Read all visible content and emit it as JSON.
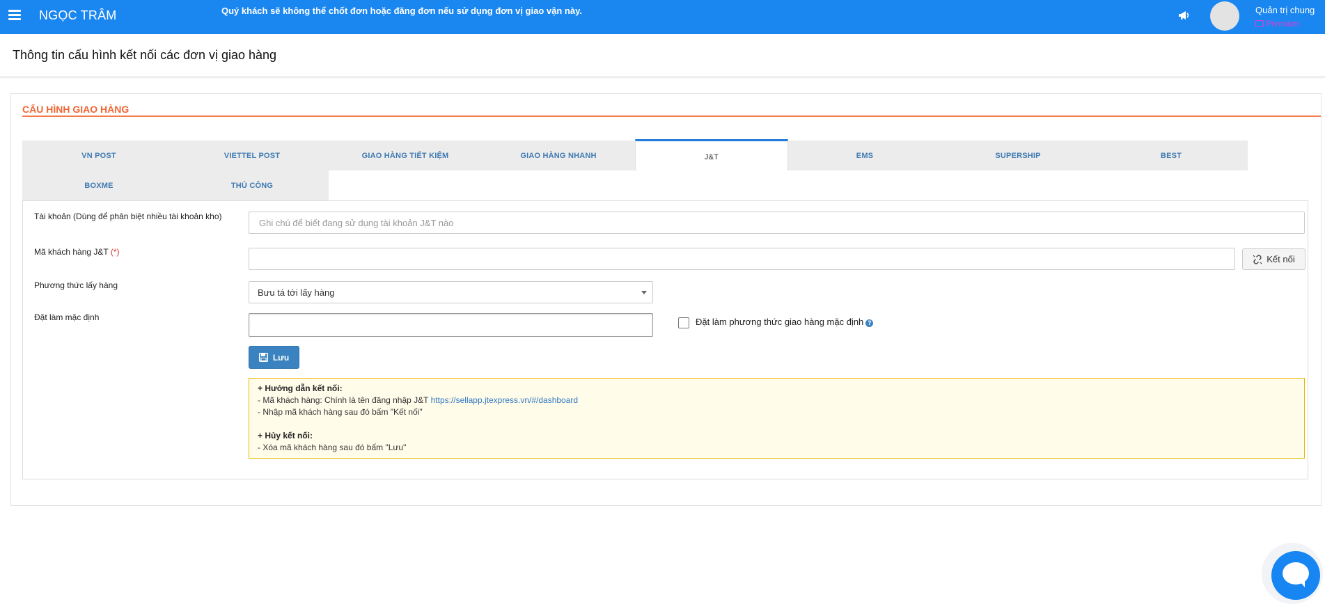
{
  "topbar": {
    "brand": "NGỌC TRÂM",
    "notice": "Quý khách sẽ không thể chốt đơn hoặc đăng đơn nếu sử dụng đơn vị giao vận này.",
    "user_name": "Quản trị chung",
    "plan": "Premium"
  },
  "page": {
    "title": "Thông tin cấu hình kết nối các đơn vị giao hàng"
  },
  "section": {
    "title": "CẤU HÌNH GIAO HÀNG"
  },
  "tabs": [
    {
      "label": "VN POST",
      "active": false
    },
    {
      "label": "VIETTEL POST",
      "active": false
    },
    {
      "label": "GIAO HÀNG TIẾT KIỆM",
      "active": false
    },
    {
      "label": "GIAO HÀNG NHANH",
      "active": false
    },
    {
      "label": "J&T",
      "active": true
    },
    {
      "label": "EMS",
      "active": false
    },
    {
      "label": "SUPERSHIP",
      "active": false
    },
    {
      "label": "BEST",
      "active": false
    },
    {
      "label": "BOXME",
      "active": false
    },
    {
      "label": "THỦ CÔNG",
      "active": false
    }
  ],
  "form": {
    "account_label": "Tài khoản (Dùng để phân biệt nhiều tài khoản kho)",
    "account_placeholder": "Ghi chú để biết đang sử dụng tài khoản J&T nào",
    "account_value": "",
    "customer_code_label": "Mã khách hàng J&T",
    "required_mark": "(*)",
    "customer_code_value": "",
    "connect_label": "Kết nối",
    "pickup_label": "Phương thức lấy hàng",
    "pickup_value": "Bưu tá tới lấy hàng",
    "default_label": "Đặt làm mặc định",
    "default_value": "",
    "default_checkbox_label": "Đặt làm phương thức giao hàng mặc định",
    "default_checked": false,
    "save_label": "Lưu"
  },
  "guide": {
    "connect_title": "+ Hướng dẫn kết nối:",
    "line1_prefix": "- Mã khách hàng: Chính là tên đăng nhập J&T ",
    "line1_link": "https://sellapp.jtexpress.vn/#/dashboard",
    "line2": "- Nhập mã khách hàng sau đó bấm \"Kết nối\"",
    "disconnect_title": "+ Hủy kết nối:",
    "line3": "- Xóa mã khách hàng sau đó bấm \"Lưu\""
  }
}
